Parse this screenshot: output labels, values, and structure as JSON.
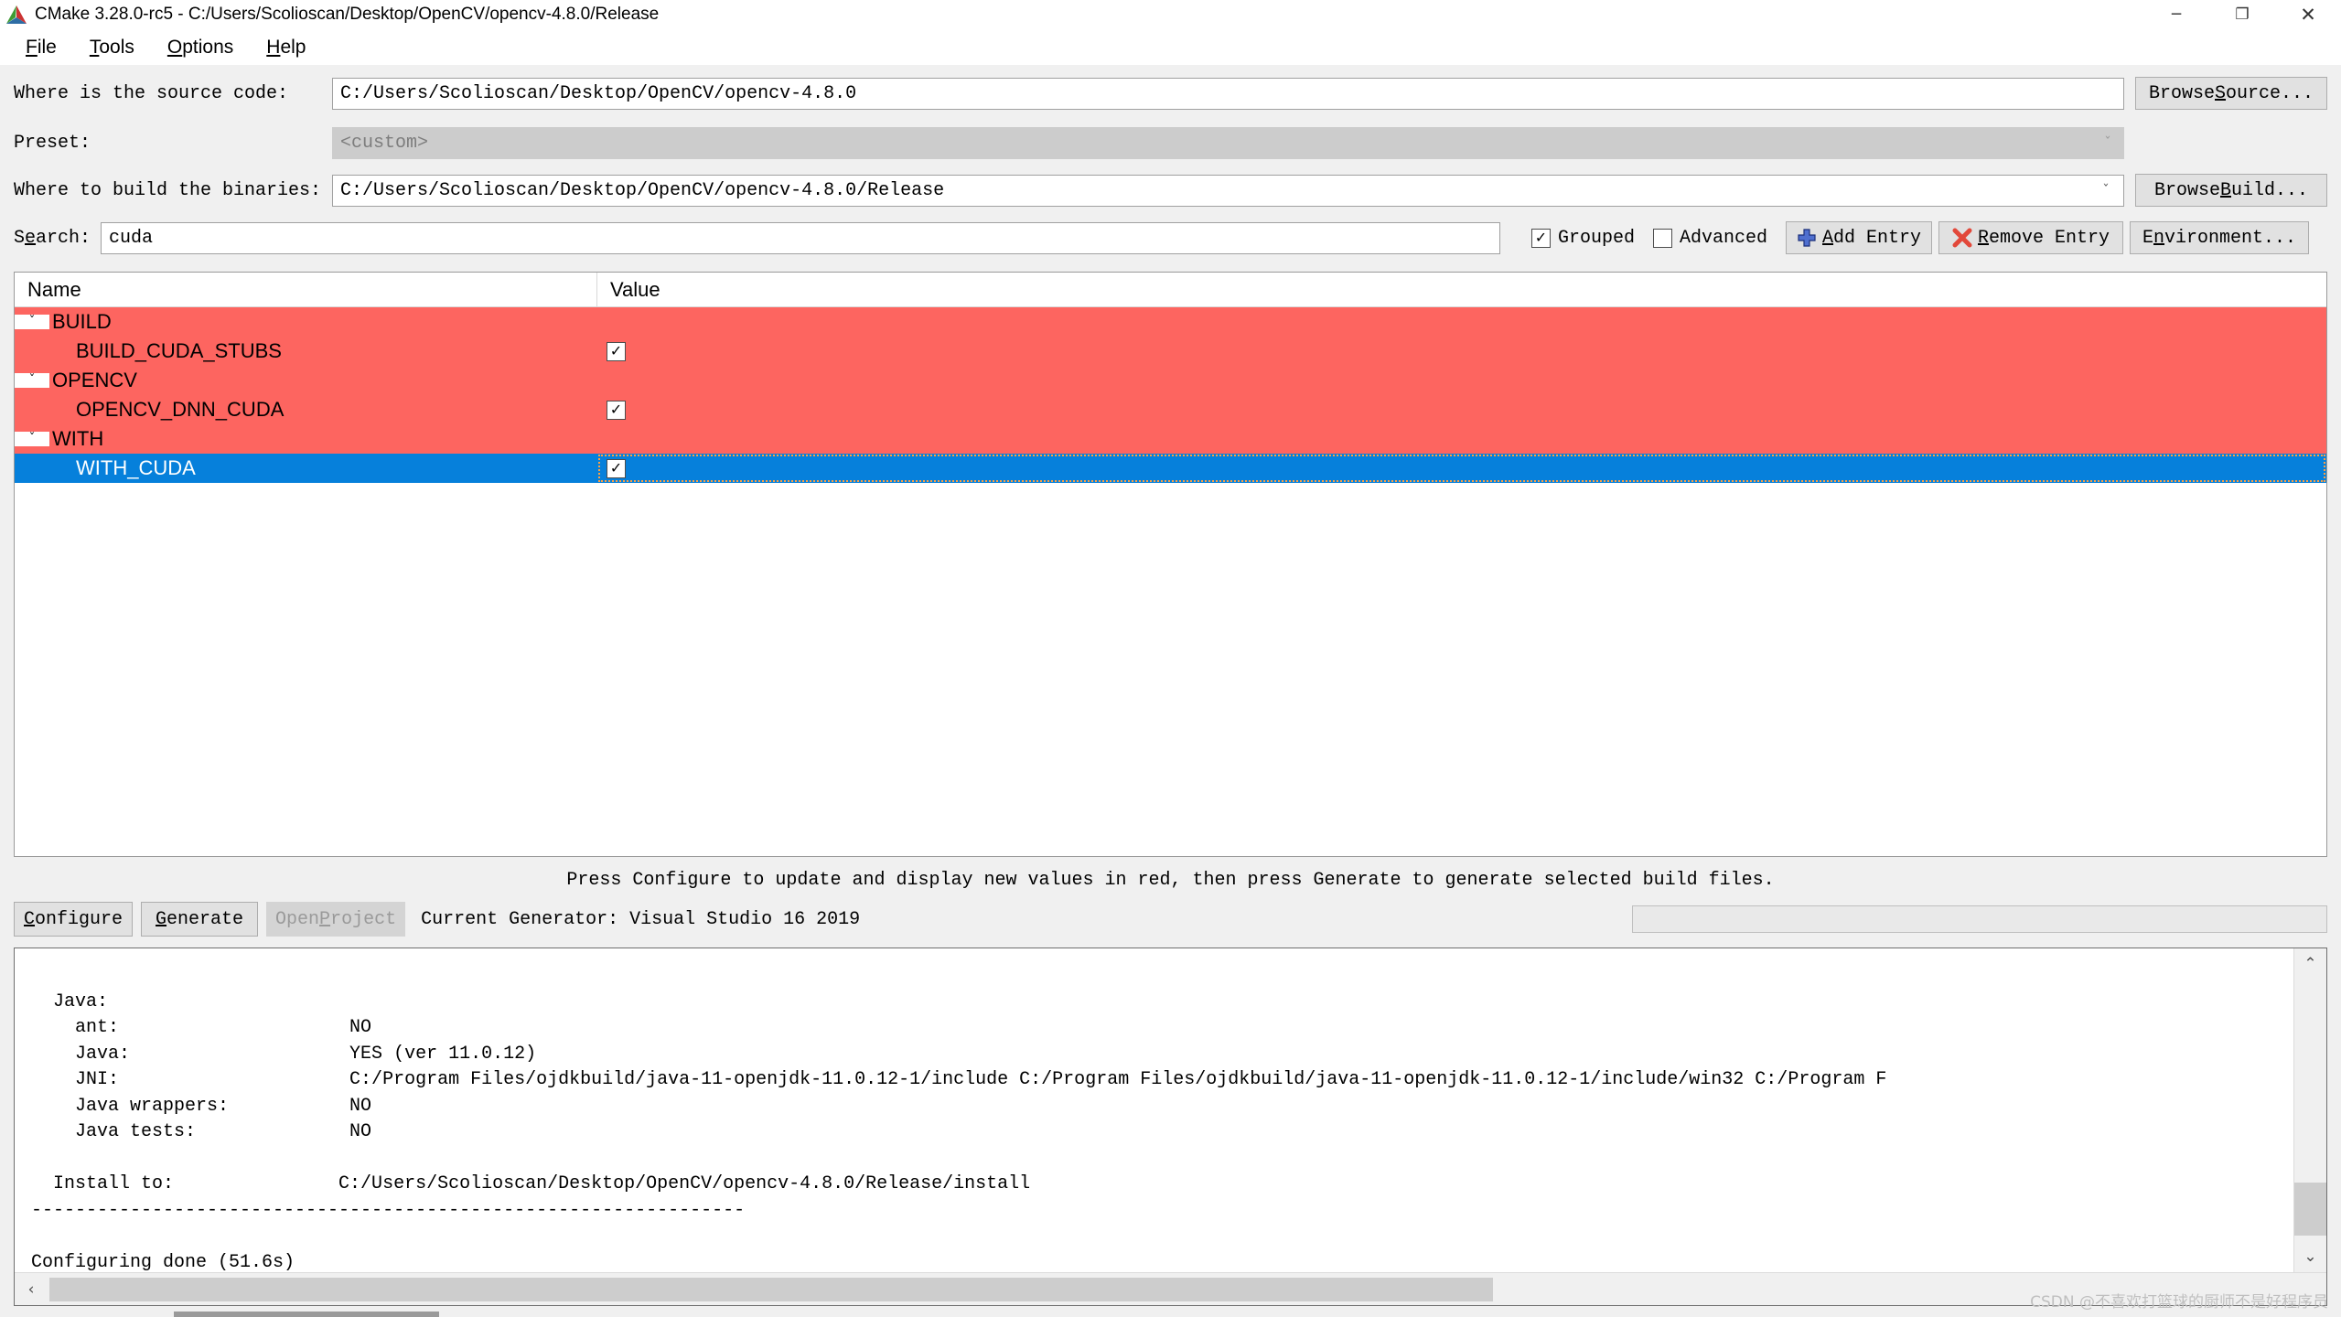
{
  "window": {
    "title": "CMake 3.28.0-rc5 - C:/Users/Scolioscan/Desktop/OpenCV/opencv-4.8.0/Release",
    "minimize": "─",
    "maximize": "❐",
    "close": "✕",
    "logo_icon": "cmake-logo-icon"
  },
  "menu": {
    "items": [
      {
        "label": "File",
        "mnemonic": "F"
      },
      {
        "label": "Tools",
        "mnemonic": "T"
      },
      {
        "label": "Options",
        "mnemonic": "O"
      },
      {
        "label": "Help",
        "mnemonic": "H"
      }
    ]
  },
  "form": {
    "source_label": "Where is the source code:",
    "source_value": "C:/Users/Scolioscan/Desktop/OpenCV/opencv-4.8.0",
    "browse_source_label": "Browse Source...",
    "browse_source_mnemonic": "S",
    "preset_label": "Preset:",
    "preset_value": "<custom>",
    "build_label": "Where to build the binaries:",
    "build_value": "C:/Users/Scolioscan/Desktop/OpenCV/opencv-4.8.0/Release",
    "browse_build_label": "Browse Build...",
    "browse_build_mnemonic": "B",
    "search_label": "Search:",
    "search_mnemonic": "e",
    "search_value": "cuda",
    "grouped_label": "Grouped",
    "grouped_checked": true,
    "advanced_label": "Advanced",
    "advanced_checked": false,
    "add_entry_label": "Add Entry",
    "add_entry_mnemonic": "A",
    "remove_entry_label": "Remove Entry",
    "remove_entry_mnemonic": "R",
    "environment_label": "Environment...",
    "environment_mnemonic": "n",
    "check_glyph": "✓",
    "chevron_down": "ˇ"
  },
  "cache": {
    "col_name": "Name",
    "col_value": "Value",
    "rows": [
      {
        "type": "group",
        "name": "BUILD",
        "state": "red",
        "expanded": true,
        "value": ""
      },
      {
        "type": "entry",
        "name": "BUILD_CUDA_STUBS",
        "state": "red",
        "checked": true
      },
      {
        "type": "group",
        "name": "OPENCV",
        "state": "red",
        "expanded": true,
        "value": ""
      },
      {
        "type": "entry",
        "name": "OPENCV_DNN_CUDA",
        "state": "red",
        "checked": true
      },
      {
        "type": "group",
        "name": "WITH",
        "state": "red",
        "expanded": true,
        "value": ""
      },
      {
        "type": "entry",
        "name": "WITH_CUDA",
        "state": "selected",
        "checked": true
      }
    ],
    "expand_glyph": "ˇ",
    "check_glyph": "✓"
  },
  "colors": {
    "new_value_red": "#fd6560",
    "selection_blue": "#0680db",
    "focus_outline": "#ffa042",
    "window_bg": "#f0f0f0"
  },
  "hint": "Press Configure to update and display new values in red, then press Generate to generate selected build files.",
  "actions": {
    "configure_label": "Configure",
    "configure_mnemonic": "C",
    "generate_label": "Generate",
    "generate_mnemonic": "G",
    "open_project_label": "Open Project",
    "open_project_mnemonic": "P",
    "open_project_disabled": true,
    "generator_text": "Current Generator: Visual Studio 16 2019"
  },
  "log": {
    "lines": [
      "",
      "  Java:",
      "    ant:                     NO",
      "    Java:                    YES (ver 11.0.12)",
      "    JNI:                     C:/Program Files/ojdkbuild/java-11-openjdk-11.0.12-1/include C:/Program Files/ojdkbuild/java-11-openjdk-11.0.12-1/include/win32 C:/Program F",
      "    Java wrappers:           NO",
      "    Java tests:              NO",
      "",
      "  Install to:               C:/Users/Scolioscan/Desktop/OpenCV/opencv-4.8.0/Release/install",
      "-----------------------------------------------------------------",
      "",
      "Configuring done (51.6s)"
    ],
    "scroll_up_glyph": "⌃",
    "scroll_down_glyph": "⌄",
    "scroll_left_glyph": "‹"
  },
  "watermark": "CSDN @不喜欢打篮球的厨师不是好程序员"
}
